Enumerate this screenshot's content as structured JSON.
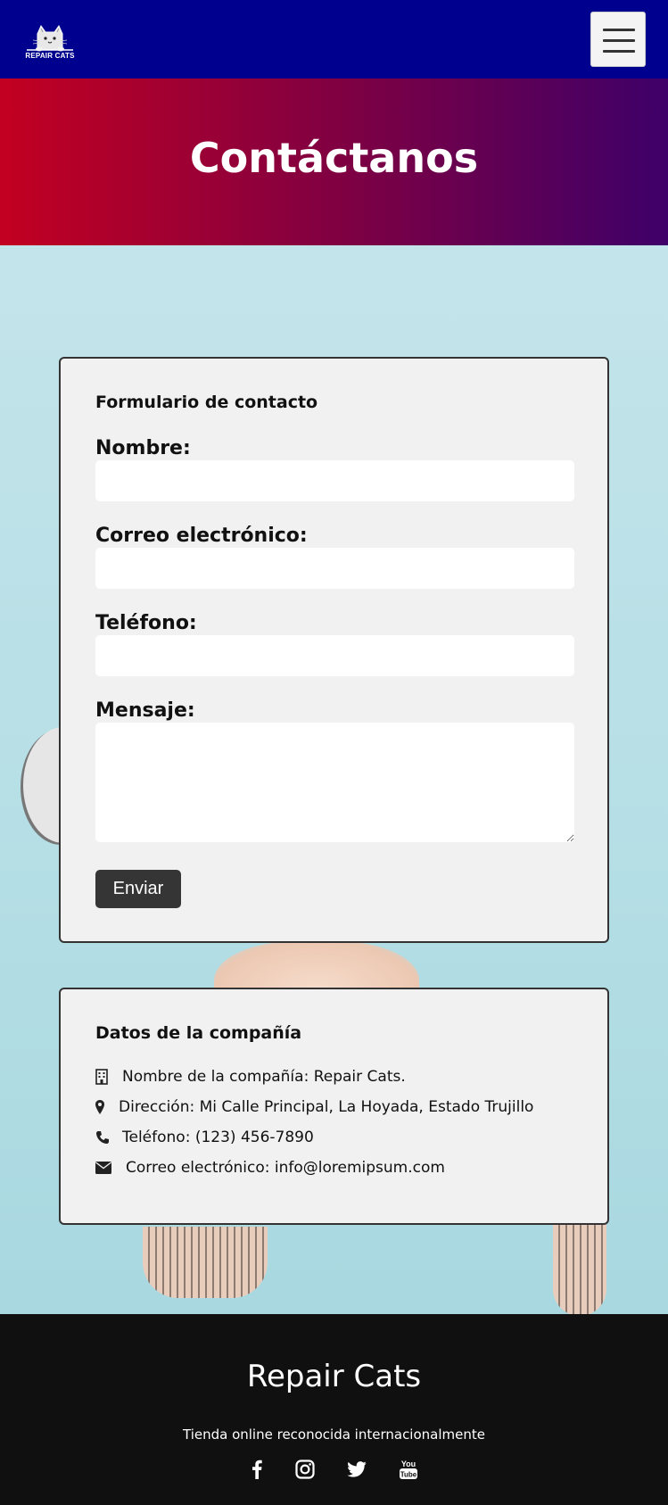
{
  "navbar": {
    "logo_text": "REPAIR CATS",
    "menu_icon": "hamburger-icon",
    "background": "#00008f"
  },
  "hero": {
    "title": "Contáctanos",
    "gradient": [
      "#c30021",
      "#3e0069"
    ]
  },
  "contact_form": {
    "heading": "Formulario de contacto",
    "fields": [
      {
        "label": "Nombre:",
        "value": ""
      },
      {
        "label": "Correo electrónico:",
        "value": ""
      },
      {
        "label": "Teléfono:",
        "value": ""
      },
      {
        "label": "Mensaje:",
        "value": ""
      }
    ],
    "submit_label": "Enviar"
  },
  "company": {
    "heading": "Datos de la compañía",
    "items": [
      {
        "icon": "building-icon",
        "text": "Nombre de la compañía: Repair Cats."
      },
      {
        "icon": "map-marker-icon",
        "text": "Dirección: Mi Calle Principal, La Hoyada, Estado Trujillo"
      },
      {
        "icon": "phone-icon",
        "text": "Teléfono: (123) 456-7890"
      },
      {
        "icon": "envelope-icon",
        "text": "Correo electrónico: info@loremipsum.com"
      }
    ]
  },
  "footer": {
    "title": "Repair Cats",
    "tagline": "Tienda online reconocida internacionalmente",
    "social_icons": [
      "facebook-icon",
      "instagram-icon",
      "twitter-icon",
      "youtube-icon"
    ],
    "background": "#101010"
  }
}
